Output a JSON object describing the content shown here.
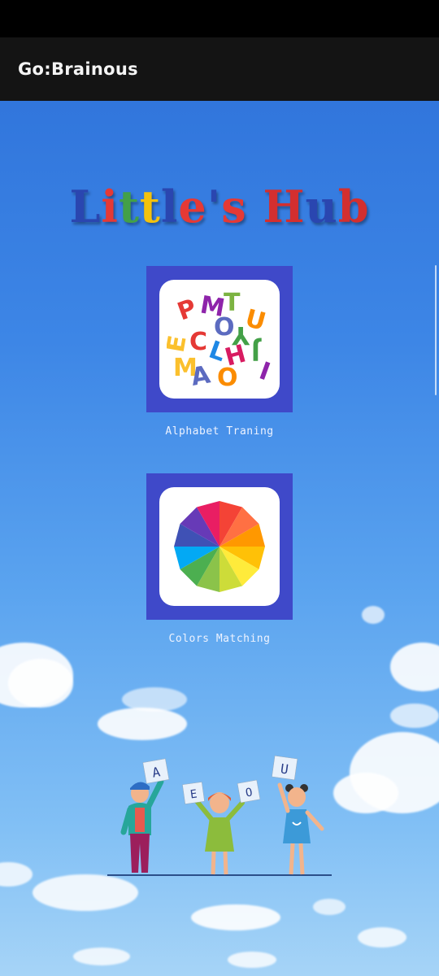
{
  "app_bar": {
    "title": "Go:Brainous"
  },
  "hub": {
    "title_letters": [
      {
        "ch": "L",
        "color": "#2a46b0"
      },
      {
        "ch": "i",
        "color": "#e53935"
      },
      {
        "ch": "t",
        "color": "#43a047"
      },
      {
        "ch": "t",
        "color": "#f4c20d"
      },
      {
        "ch": "l",
        "color": "#2a46b0"
      },
      {
        "ch": "e",
        "color": "#e53935"
      },
      {
        "ch": "'",
        "color": "#2a46b0"
      },
      {
        "ch": "s",
        "color": "#e53935"
      },
      {
        "ch": " ",
        "color": "#000000"
      },
      {
        "ch": "H",
        "color": "#d32f2f"
      },
      {
        "ch": "u",
        "color": "#2a46b0"
      },
      {
        "ch": "b",
        "color": "#d32f2f"
      }
    ]
  },
  "cards": [
    {
      "label": "Alphabet Traning",
      "icon": "alphabet-letters-icon"
    },
    {
      "label": "Colors Matching",
      "icon": "color-wheel-icon"
    }
  ],
  "illustration": {
    "cards": [
      "A",
      "E",
      "O",
      "U"
    ]
  },
  "colors": {
    "app_bar": "#141414",
    "tile_bg": "#3f49c9",
    "sky_top": "#2c6fd8",
    "sky_bottom": "#a6d4f7"
  }
}
